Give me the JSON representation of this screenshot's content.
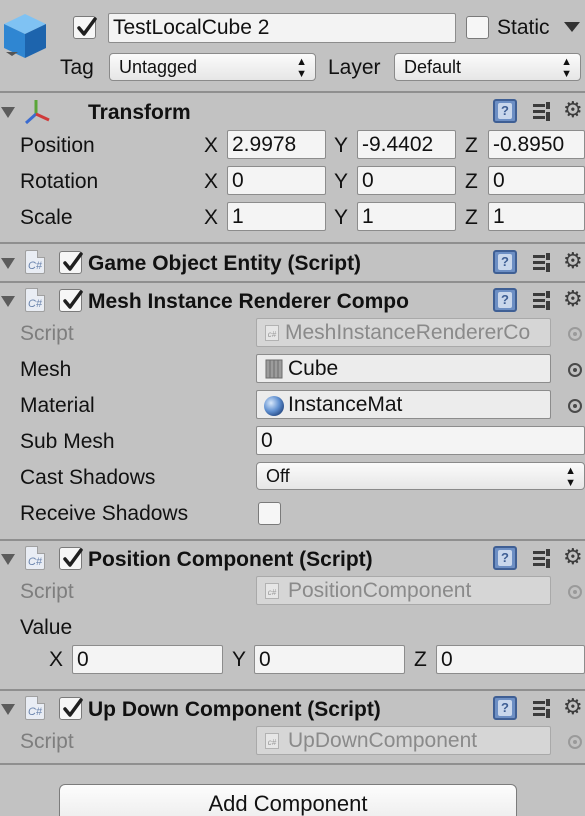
{
  "header": {
    "object_name": "TestLocalCube 2",
    "static_label": "Static",
    "tag_label": "Tag",
    "tag_value": "Untagged",
    "layer_label": "Layer",
    "layer_value": "Default",
    "active": true,
    "static_checked": false
  },
  "transform": {
    "title": "Transform",
    "position_label": "Position",
    "rotation_label": "Rotation",
    "scale_label": "Scale",
    "x_label": "X",
    "y_label": "Y",
    "z_label": "Z",
    "position": {
      "x": "2.9978",
      "y": "-9.4402",
      "z": "-0.8950"
    },
    "rotation": {
      "x": "0",
      "y": "0",
      "z": "0"
    },
    "scale": {
      "x": "1",
      "y": "1",
      "z": "1"
    }
  },
  "game_object_entity": {
    "title": "Game Object Entity (Script)",
    "enabled": true
  },
  "mesh_renderer": {
    "title": "Mesh Instance Renderer Compo",
    "enabled": true,
    "script_label": "Script",
    "script_value": "MeshInstanceRendererCo",
    "mesh_label": "Mesh",
    "mesh_value": "Cube",
    "material_label": "Material",
    "material_value": "InstanceMat",
    "submesh_label": "Sub Mesh",
    "submesh_value": "0",
    "cast_shadows_label": "Cast Shadows",
    "cast_shadows_value": "Off",
    "receive_shadows_label": "Receive Shadows",
    "receive_shadows_checked": false
  },
  "position_component": {
    "title": "Position Component (Script)",
    "enabled": true,
    "script_label": "Script",
    "script_value": "PositionComponent",
    "value_label": "Value",
    "x_label": "X",
    "y_label": "Y",
    "z_label": "Z",
    "value": {
      "x": "0",
      "y": "0",
      "z": "0"
    }
  },
  "up_down_component": {
    "title": "Up Down Component (Script)",
    "enabled": true,
    "script_label": "Script",
    "script_value": "UpDownComponent"
  },
  "add_component_label": "Add Component",
  "icons": {
    "cs_text": "C#",
    "small_cs_text": "c#",
    "help_text": "?"
  },
  "colors": {
    "panel_bg": "#c2c2c2",
    "field_bg": "#f4f4f4",
    "help_blue": "#6d8fc4",
    "cube_blue": "#3a8fd8"
  }
}
